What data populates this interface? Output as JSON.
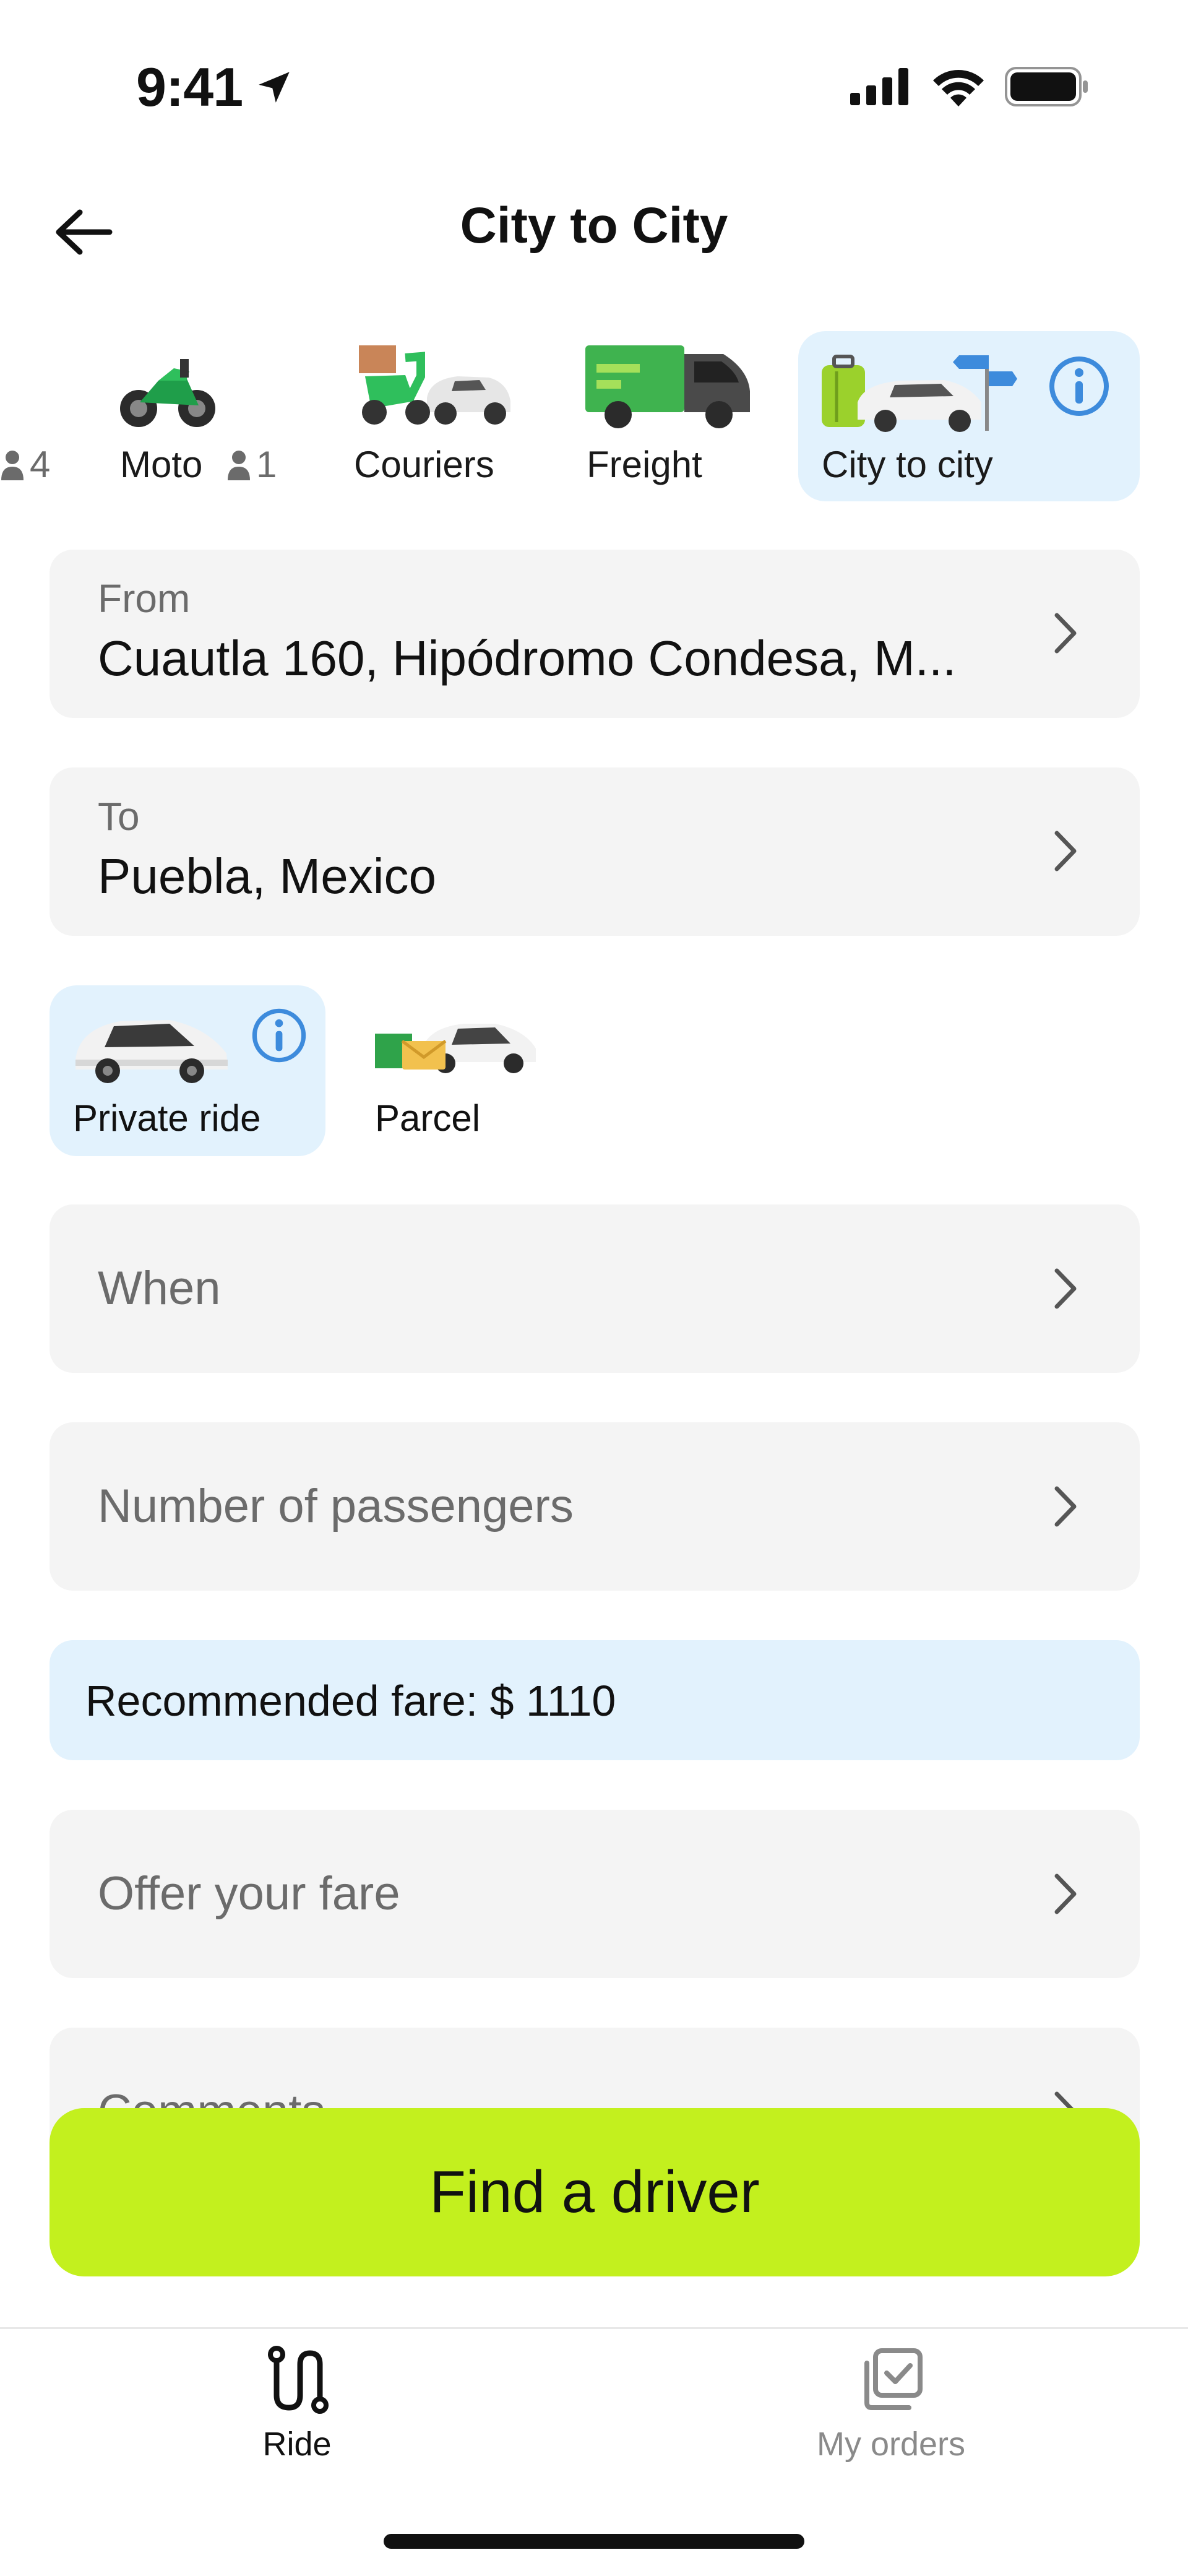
{
  "status_bar": {
    "time": "9:41"
  },
  "header": {
    "title": "City to City"
  },
  "categories": [
    {
      "label": "4",
      "kind": "count-only"
    },
    {
      "label": "Moto",
      "count": "1"
    },
    {
      "label": "Couriers"
    },
    {
      "label": "Freight"
    },
    {
      "label": "City to city",
      "selected": true
    }
  ],
  "route": {
    "from_label": "From",
    "from_value": "Cuautla 160, Hipódromo Condesa, M...",
    "to_label": "To",
    "to_value": "Puebla, Mexico"
  },
  "ride_types": [
    {
      "label": "Private ride",
      "selected": true
    },
    {
      "label": "Parcel"
    }
  ],
  "fields": {
    "when": "When",
    "passengers": "Number of passengers",
    "offer_fare": "Offer your fare",
    "comments": "Comments"
  },
  "fare": {
    "recommended": "Recommended fare: $ 1110"
  },
  "actions": {
    "find_driver": "Find a driver"
  },
  "nav": {
    "ride": "Ride",
    "orders": "My orders"
  },
  "colors": {
    "accent": "#c3f01e",
    "selected_bg": "#e2f2fd",
    "info_blue": "#3d8bdc"
  }
}
